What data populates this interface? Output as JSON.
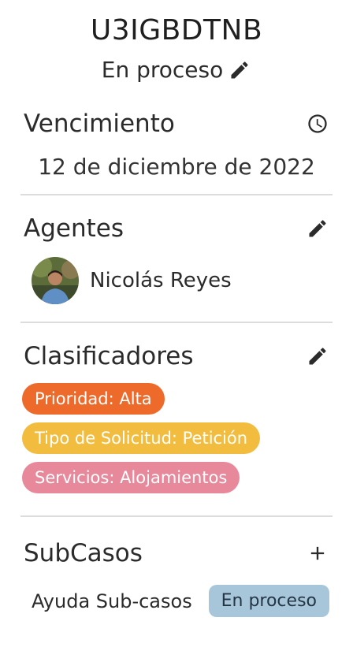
{
  "case": {
    "id": "U3IGBDTNB",
    "status": "En proceso"
  },
  "due": {
    "title": "Vencimiento",
    "date": "12 de diciembre de 2022"
  },
  "agents": {
    "title": "Agentes",
    "items": [
      {
        "name": "Nicolás Reyes"
      }
    ]
  },
  "classifiers": {
    "title": "Clasificadores",
    "chips": [
      {
        "label": "Prioridad: Alta",
        "color": "#ee6a2b"
      },
      {
        "label": "Tipo de Solicitud: Petición",
        "color": "#f2bc3e"
      },
      {
        "label": "Servicios: Alojamientos",
        "color": "#e8889b"
      }
    ]
  },
  "subcases": {
    "title": "SubCasos",
    "items": [
      {
        "name": "Ayuda Sub-casos",
        "status": "En proceso"
      }
    ]
  }
}
